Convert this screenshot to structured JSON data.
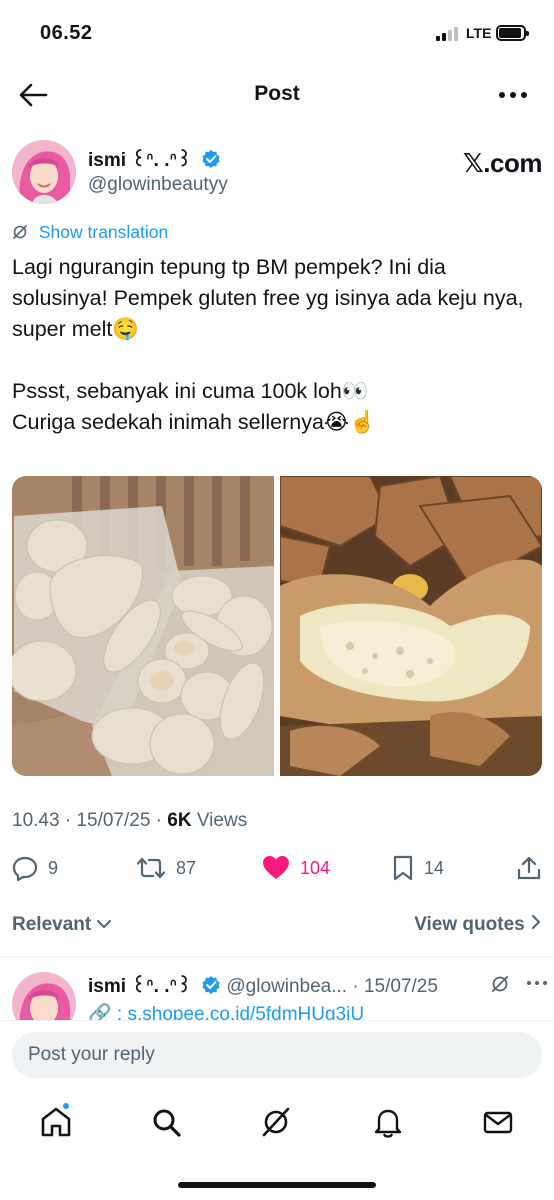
{
  "status_bar": {
    "time": "06.52",
    "network": "LTE"
  },
  "nav": {
    "title": "Post",
    "back_icon": "arrow-left-icon",
    "more_icon": "more-horizontal-icon"
  },
  "post": {
    "author_name": "ismi ꒰ᐢ. .ᐢ꒱",
    "author_handle": "@glowinbeautyy",
    "site": "𝕏.com",
    "show_translation": "Show translation",
    "text": "Lagi ngurangin tepung tp BM pempek? Ini dia solusinya! Pempek gluten free yg isinya ada keju nya, super melt🤤\n\nPssst, sebanyak ini cuma 100k loh👀\nCuriga sedekah inimah sellernya😭☝️",
    "time": "10.43 · 15/07/25 · ",
    "views_count": "6K",
    "views_label": " Views",
    "replies": "9",
    "reposts": "87",
    "likes": "104",
    "bookmarks": "14",
    "accent_color": "#1d9bf0",
    "like_color": "#f91880"
  },
  "sort": {
    "label": "Relevant",
    "view_quotes": "View quotes"
  },
  "reply": {
    "name": "ismi ꒰ᐢ. .ᐢ꒱",
    "handle_date": "@glowinbea... · 15/07/25",
    "body": "🔗 : s.shopee.co.id/5fdmHUg3iU"
  },
  "composer": {
    "placeholder": "Post your reply"
  },
  "tabbar": [
    "home-icon",
    "search-icon",
    "grok-icon",
    "notifications-icon",
    "messages-icon"
  ]
}
